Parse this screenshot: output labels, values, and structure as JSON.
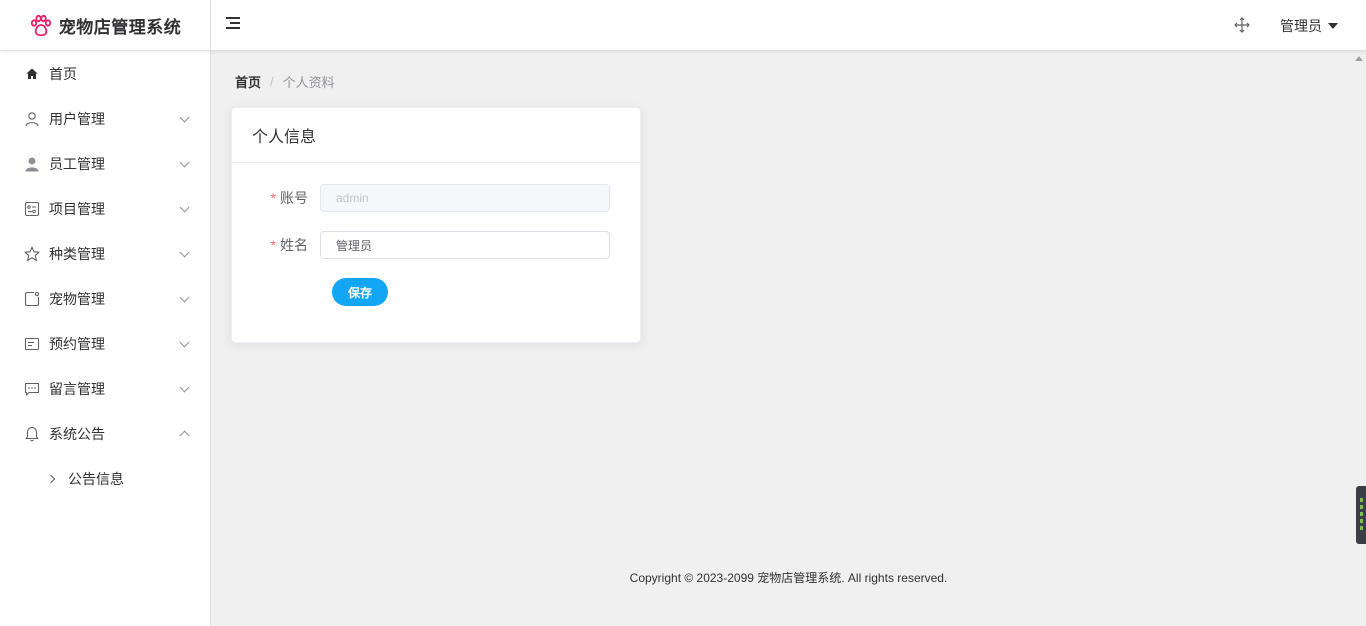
{
  "app": {
    "title": "宠物店管理系统",
    "logo_icon": "paw-icon",
    "logo_color": "#e91e63"
  },
  "header": {
    "menu_toggle_icon": "hamburger-icon",
    "fullscreen_icon": "move-arrows-icon",
    "user_label": "管理员",
    "user_caret_icon": "caret-down-icon"
  },
  "sidebar": {
    "items": [
      {
        "label": "首页",
        "icon": "home-icon"
      },
      {
        "label": "用户管理",
        "icon": "user-icon",
        "expandable": true
      },
      {
        "label": "员工管理",
        "icon": "staff-icon",
        "expandable": true
      },
      {
        "label": "项目管理",
        "icon": "project-icon",
        "expandable": true
      },
      {
        "label": "种类管理",
        "icon": "star-icon",
        "expandable": true
      },
      {
        "label": "宠物管理",
        "icon": "pet-icon",
        "expandable": true
      },
      {
        "label": "预约管理",
        "icon": "appointment-icon",
        "expandable": true
      },
      {
        "label": "留言管理",
        "icon": "message-icon",
        "expandable": true
      },
      {
        "label": "系统公告",
        "icon": "bell-icon",
        "expandable": true,
        "expanded": true
      }
    ],
    "subitems": [
      {
        "label": "公告信息"
      }
    ]
  },
  "breadcrumb": {
    "home": "首页",
    "separator": "/",
    "current": "个人资料"
  },
  "card": {
    "title": "个人信息",
    "fields": {
      "account": {
        "label": "账号",
        "value": "admin",
        "disabled": true
      },
      "name": {
        "label": "姓名",
        "value": "管理员"
      }
    },
    "required_mark": "*",
    "save_label": "保存"
  },
  "footer": {
    "copyright": "Copyright © 2023-2099 宠物店管理系统. All rights reserved."
  },
  "colors": {
    "primary_button": "#13a6f5",
    "required": "#f56c6c",
    "background": "#f0f0f0"
  }
}
